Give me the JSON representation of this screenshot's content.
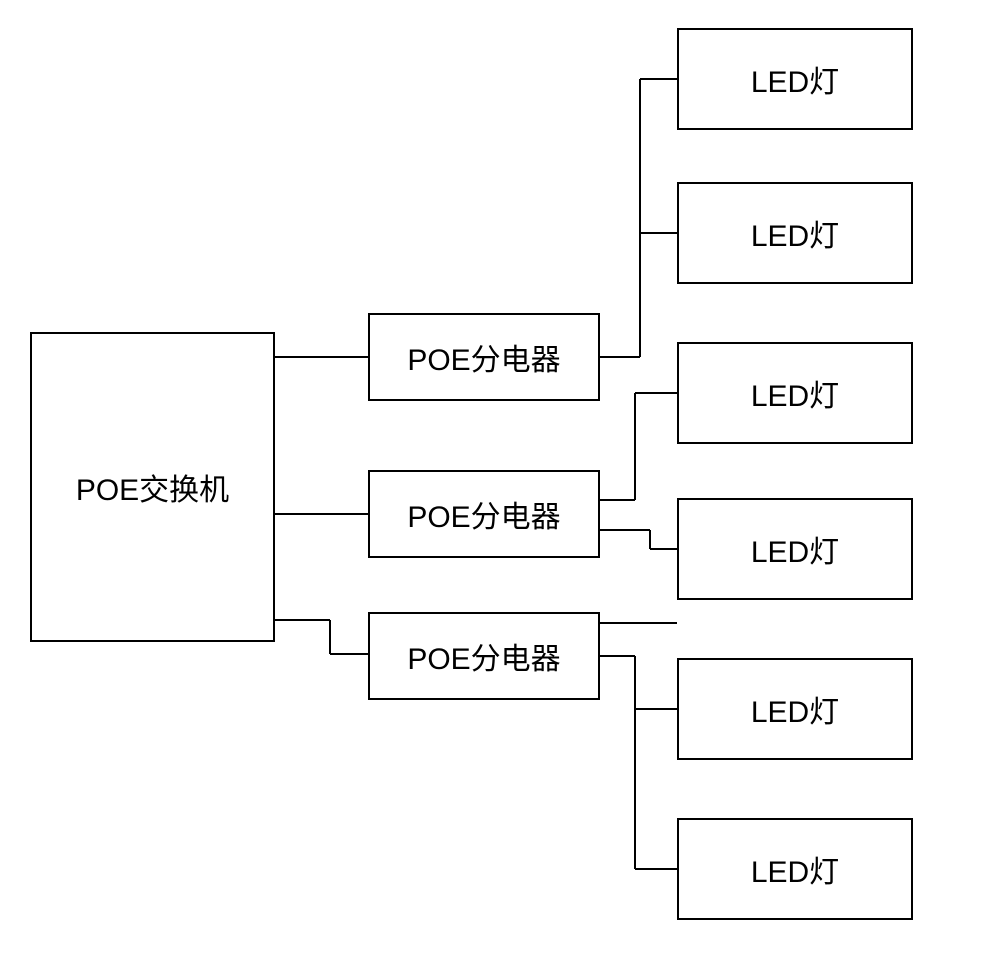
{
  "diagram": {
    "main_box": "POE交换机",
    "mid_boxes": [
      "POE分电器",
      "POE分电器",
      "POE分电器"
    ],
    "led_boxes": [
      "LED灯",
      "LED灯",
      "LED灯",
      "LED灯",
      "LED灯",
      "LED灯"
    ]
  }
}
